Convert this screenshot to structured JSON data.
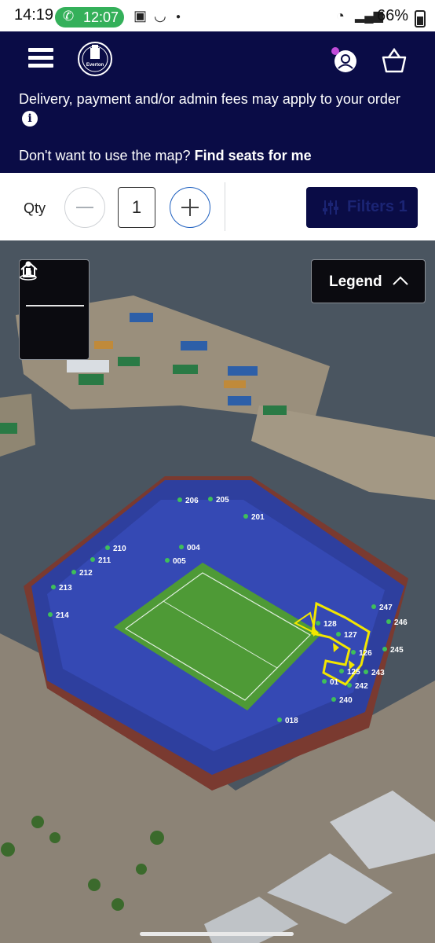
{
  "status": {
    "time": "14:19",
    "call_time": "12:07",
    "battery": "66%"
  },
  "header": {
    "crest_text": "Everton",
    "fees_notice": "Delivery, payment and/or admin fees may apply to your order",
    "map_prompt": "Don't want to use the map?",
    "map_link": "Find seats for me"
  },
  "controls": {
    "qty_label": "Qty",
    "qty_value": "1",
    "filters_label": "Filters 1"
  },
  "map": {
    "legend_label": "Legend",
    "sections": [
      {
        "id": "206",
        "label": "206"
      },
      {
        "id": "205",
        "label": "205"
      },
      {
        "id": "201",
        "label": "201"
      },
      {
        "id": "210",
        "label": "210"
      },
      {
        "id": "004",
        "label": "004"
      },
      {
        "id": "211",
        "label": "211"
      },
      {
        "id": "005",
        "label": "005"
      },
      {
        "id": "212",
        "label": "212"
      },
      {
        "id": "213",
        "label": "213"
      },
      {
        "id": "214",
        "label": "214"
      },
      {
        "id": "247",
        "label": "247"
      },
      {
        "id": "246",
        "label": "246"
      },
      {
        "id": "128",
        "label": "128"
      },
      {
        "id": "127",
        "label": "127"
      },
      {
        "id": "126",
        "label": "126"
      },
      {
        "id": "245",
        "label": "245"
      },
      {
        "id": "125",
        "label": "125"
      },
      {
        "id": "243",
        "label": "243"
      },
      {
        "id": "01",
        "label": "01"
      },
      {
        "id": "242",
        "label": "242"
      },
      {
        "id": "240",
        "label": "240"
      },
      {
        "id": "018",
        "label": "018"
      }
    ]
  },
  "colors": {
    "header_bg": "#0a0c46",
    "seat_blue": "#2e3f9e",
    "pitch_green": "#4e9a36",
    "available_dot": "#3fbf5a",
    "selection": "#f2e600",
    "call_green": "#34b05a"
  }
}
